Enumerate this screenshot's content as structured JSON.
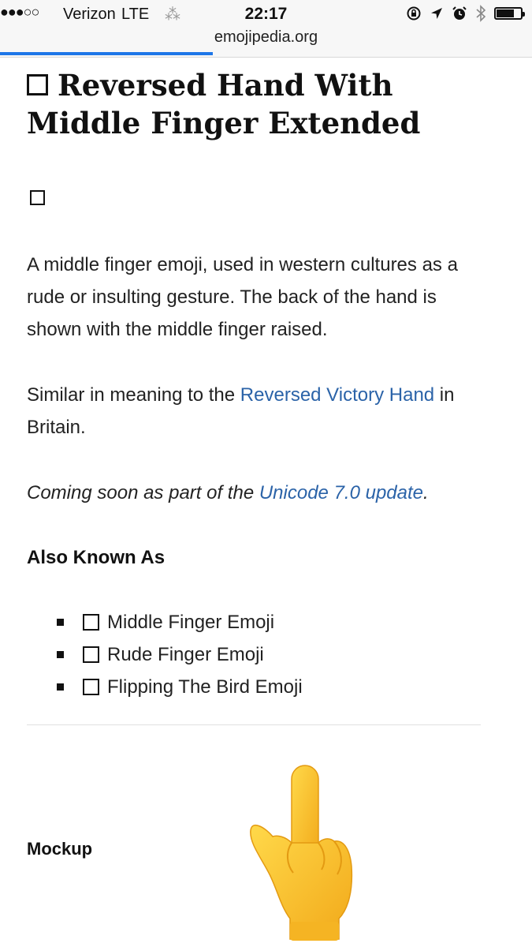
{
  "status_bar": {
    "signal": "●●●○○",
    "carrier": "Verizon",
    "network": "LTE",
    "time": "22:17",
    "battery_level": 0.8
  },
  "browser": {
    "url": "emojipedia.org",
    "load_progress": 0.4
  },
  "article": {
    "title": "Reversed Hand With Middle Finger Extended",
    "description": "A middle finger emoji, used in western cultures as a rude or insulting gesture. The back of the hand is shown with the middle finger raised.",
    "similar_prefix": "Similar in meaning to the ",
    "similar_link": "Reversed Victory Hand",
    "similar_suffix": " in Britain.",
    "coming_prefix": "Coming soon as part of the ",
    "coming_link": "Unicode 7.0 update",
    "coming_suffix": ".",
    "aka_heading": "Also Known As",
    "aka": [
      "Middle Finger Emoji",
      "Rude Finger Emoji",
      "Flipping The Bird Emoji"
    ],
    "mockup_label": "Mockup"
  },
  "colors": {
    "link": "#2b63a8",
    "progress": "#1e76e8",
    "hand_fill": "#f9c22e"
  },
  "icons": {
    "status_right": [
      "rotation-lock-icon",
      "location-arrow-icon",
      "alarm-icon",
      "bluetooth-icon",
      "battery-icon"
    ],
    "spinner": "loading-spinner-icon",
    "mockup": "middle-finger-emoji-icon"
  }
}
